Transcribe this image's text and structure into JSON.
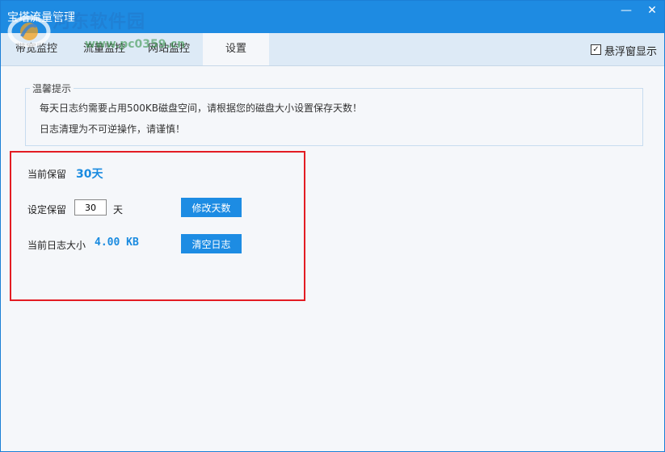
{
  "window": {
    "title": "宝塔流量管理",
    "minimize_glyph": "—",
    "close_glyph": "✕"
  },
  "watermark": {
    "name": "河东软件园",
    "url": "www.pc0359.cn"
  },
  "tabs": [
    {
      "label": "带宽监控",
      "active": false
    },
    {
      "label": "流量监控",
      "active": false
    },
    {
      "label": "网站监控",
      "active": false
    },
    {
      "label": "设置",
      "active": true
    }
  ],
  "float_window": {
    "label": "悬浮窗显示",
    "checked": true,
    "check_glyph": "✓"
  },
  "tips": {
    "title": "温馨提示",
    "line1": "每天日志约需要占用500KB磁盘空间，请根据您的磁盘大小设置保存天数！",
    "line2": "日志清理为不可逆操作，请谨慎！"
  },
  "settings": {
    "current_retain_label": "当前保留",
    "current_retain_value": "30天",
    "set_retain_label": "设定保留",
    "days_input_value": "30",
    "days_unit": "天",
    "modify_button": "修改天数",
    "log_size_label": "当前日志大小",
    "log_size_value": "4.00 KB",
    "clear_button": "清空日志"
  },
  "colors": {
    "accent": "#1e8be2",
    "highlight": "#e31c23"
  }
}
